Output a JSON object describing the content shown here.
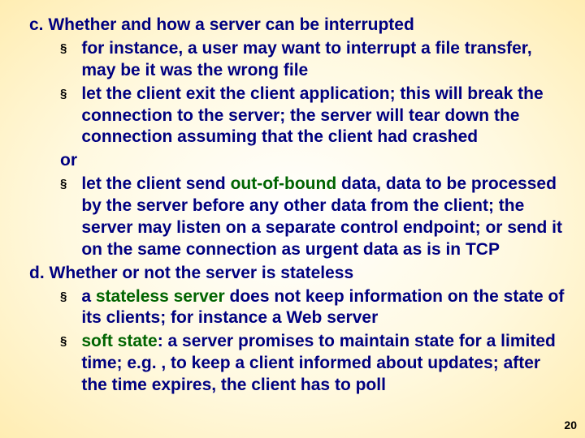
{
  "slide": {
    "items": [
      {
        "letter": "c.",
        "heading": "Whether and how a server can be interrupted",
        "bullets": [
          {
            "fragments": [
              {
                "text": "for instance, a user may want to interrupt a file transfer, may be it was the wrong file"
              }
            ]
          },
          {
            "fragments": [
              {
                "text": "let the client exit the client application; this will break the connection to the server; the server will tear down the connection assuming that the client had crashed"
              }
            ]
          },
          {
            "or": true,
            "text": "or"
          },
          {
            "fragments": [
              {
                "text": "let the client send "
              },
              {
                "text": "out-of-bound",
                "term": true
              },
              {
                "text": " data, data to be processed by the server before any other data from the client; the server may listen on a separate control endpoint; or send it on the same connection as urgent data as is in TCP"
              }
            ]
          }
        ]
      },
      {
        "letter": "d.",
        "heading": "Whether or not the server is stateless",
        "bullets": [
          {
            "fragments": [
              {
                "text": "a "
              },
              {
                "text": "stateless server",
                "term": true
              },
              {
                "text": " does not keep information on the state of its clients; for instance a Web server"
              }
            ]
          },
          {
            "fragments": [
              {
                "text": "soft state",
                "term": true
              },
              {
                "text": ": a server promises to maintain state for a limited time; e.g. , to keep a client informed about updates; after the time expires, the client has to poll"
              }
            ]
          }
        ]
      }
    ],
    "page_number": "20",
    "bullet_glyph": "§"
  }
}
